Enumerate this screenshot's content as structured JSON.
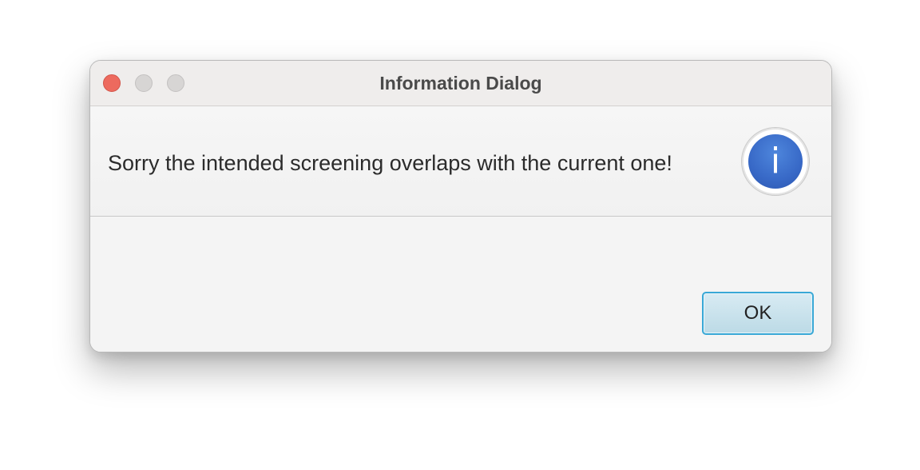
{
  "window": {
    "title": "Information Dialog"
  },
  "dialog": {
    "message": "Sorry the intended screening overlaps with the current one!",
    "icon": "info-icon",
    "icon_glyph": "i",
    "ok_label": "OK"
  },
  "colors": {
    "close_button": "#ed6a5e",
    "inactive_button": "#d7d5d4",
    "info_icon": "#3869c7",
    "ok_border": "#39a8d6"
  }
}
